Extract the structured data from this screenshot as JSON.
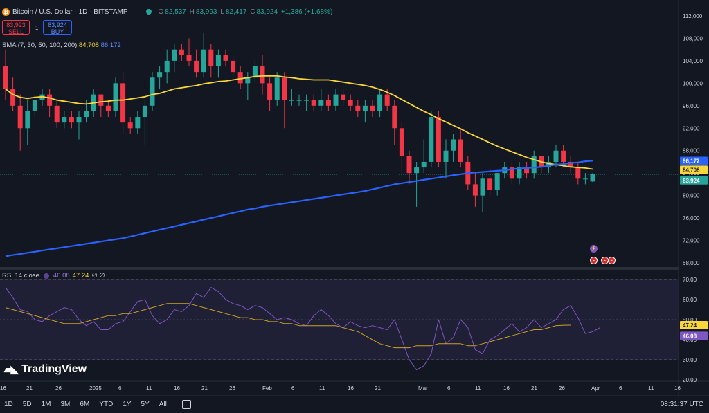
{
  "header": {
    "pair": "Bitcoin / U.S. Dollar · 1D · BITSTAMP",
    "open_label": "O",
    "open": "82,537",
    "high_label": "H",
    "high": "83,993",
    "low_label": "L",
    "low": "82,417",
    "close_label": "C",
    "close": "83,924",
    "change": "+1,386 (+1.68%)"
  },
  "trade": {
    "sell_price": "83,923",
    "sell_label": "SELL",
    "spread": "1",
    "buy_price": "83,924",
    "buy_label": "BUY"
  },
  "sma": {
    "label": "SMA (7, 30, 50, 100, 200)",
    "val1": "84,708",
    "val2": "86,172"
  },
  "rsi": {
    "label": "RSI 14 close",
    "val1": "46.08",
    "val2": "47.24",
    "rest": "∅ ∅"
  },
  "price_axis": [
    "112,000",
    "108,000",
    "104,000",
    "100,000",
    "96,000",
    "92,000",
    "88,000",
    "84,000",
    "80,000",
    "76,000",
    "72,000",
    "68,000"
  ],
  "price_tags": {
    "sma200": "86,172",
    "sma50": "84,708",
    "last": "83,924"
  },
  "rsi_axis": [
    "70.00",
    "60.00",
    "50.00",
    "40.00",
    "30.00",
    "20.00"
  ],
  "rsi_tags": {
    "ma": "47.24",
    "rsi": "46.08"
  },
  "time_axis": [
    "16",
    "21",
    "26",
    "2025",
    "6",
    "11",
    "16",
    "21",
    "26",
    "Feb",
    "6",
    "11",
    "16",
    "21",
    "Mar",
    "6",
    "11",
    "16",
    "21",
    "26",
    "Apr",
    "6",
    "11",
    "16"
  ],
  "logo": "TradingView",
  "bottom": {
    "timeframes": [
      "1D",
      "5D",
      "1M",
      "3M",
      "6M",
      "YTD",
      "1Y",
      "5Y",
      "All"
    ],
    "clock": "08:31:37 UTC"
  },
  "colors": {
    "bg": "#131722",
    "up": "#26a69a",
    "down": "#f23645",
    "sma_yellow": "#f7d73b",
    "sma_blue": "#2962ff",
    "rsi": "#7e57c2"
  },
  "chart_data": {
    "type": "candlestick",
    "series": [
      {
        "name": "BTC/USD",
        "ohlc_k": [
          [
            103,
            106,
            97,
            99
          ],
          [
            99,
            101,
            95,
            96
          ],
          [
            96,
            98,
            88,
            92
          ],
          [
            92,
            97,
            89,
            95
          ],
          [
            95,
            98,
            94,
            97
          ],
          [
            97,
            99,
            96,
            98
          ],
          [
            98,
            99,
            94,
            96
          ],
          [
            96,
            97,
            92,
            93
          ],
          [
            93,
            95,
            92,
            94
          ],
          [
            94,
            95,
            92,
            93
          ],
          [
            93,
            95,
            90,
            94
          ],
          [
            94,
            97,
            93,
            95
          ],
          [
            95,
            99,
            94,
            98
          ],
          [
            98,
            98,
            94,
            96
          ],
          [
            96,
            97,
            94,
            95
          ],
          [
            95,
            101,
            94,
            100
          ],
          [
            100,
            102,
            91,
            93
          ],
          [
            93,
            94,
            91,
            92
          ],
          [
            92,
            95,
            91,
            94
          ],
          [
            94,
            97,
            89,
            96
          ],
          [
            96,
            102,
            95,
            101
          ],
          [
            101,
            103,
            99,
            102
          ],
          [
            102,
            106,
            100,
            104
          ],
          [
            104,
            107,
            102,
            106
          ],
          [
            106,
            107,
            104,
            105
          ],
          [
            105,
            108,
            103,
            104
          ],
          [
            104,
            106,
            101,
            102
          ],
          [
            102,
            109,
            101,
            106
          ],
          [
            106,
            107,
            101,
            103
          ],
          [
            103,
            106,
            101,
            105
          ],
          [
            105,
            106,
            103,
            104
          ],
          [
            104,
            105,
            101,
            102
          ],
          [
            102,
            103,
            99,
            100
          ],
          [
            100,
            102,
            97,
            101
          ],
          [
            101,
            104,
            100,
            103
          ],
          [
            103,
            105,
            98,
            100
          ],
          [
            100,
            101,
            95,
            97
          ],
          [
            97,
            102,
            96,
            101
          ],
          [
            101,
            102,
            92,
            97
          ],
          [
            97,
            99,
            96,
            97
          ],
          [
            97,
            98,
            96,
            97
          ],
          [
            97,
            98,
            95,
            97
          ],
          [
            97,
            98,
            95,
            96
          ],
          [
            96,
            99,
            95,
            97
          ],
          [
            97,
            98,
            95,
            96
          ],
          [
            96,
            99,
            95,
            98
          ],
          [
            98,
            99,
            96,
            97
          ],
          [
            97,
            98,
            95,
            96
          ],
          [
            96,
            97,
            94,
            95
          ],
          [
            95,
            97,
            93,
            96
          ],
          [
            96,
            97,
            94,
            95
          ],
          [
            95,
            99,
            94,
            98
          ],
          [
            98,
            99,
            95,
            96
          ],
          [
            96,
            97,
            89,
            92
          ],
          [
            92,
            93,
            84,
            87
          ],
          [
            87,
            88,
            82,
            84
          ],
          [
            84,
            86,
            78,
            85
          ],
          [
            85,
            90,
            84,
            86
          ],
          [
            86,
            95,
            85,
            94
          ],
          [
            94,
            95,
            85,
            86
          ],
          [
            86,
            90,
            83,
            88
          ],
          [
            88,
            91,
            86,
            90
          ],
          [
            90,
            92,
            85,
            86
          ],
          [
            86,
            87,
            81,
            82
          ],
          [
            82,
            84,
            78,
            80
          ],
          [
            80,
            84,
            77,
            83
          ],
          [
            83,
            85,
            80,
            81
          ],
          [
            81,
            84,
            80,
            84
          ],
          [
            84,
            86,
            83,
            85
          ],
          [
            85,
            86,
            82,
            83
          ],
          [
            83,
            86,
            82,
            85
          ],
          [
            85,
            86,
            83,
            84
          ],
          [
            84,
            88,
            83,
            87
          ],
          [
            87,
            87,
            84,
            85
          ],
          [
            85,
            87,
            84,
            86
          ],
          [
            86,
            89,
            85,
            88
          ],
          [
            88,
            89,
            85,
            86
          ],
          [
            86,
            87,
            84,
            85
          ],
          [
            85,
            86,
            82,
            83
          ],
          [
            83,
            84,
            82,
            83
          ],
          [
            82.5,
            84,
            82.4,
            83.9
          ]
        ]
      },
      {
        "name": "SMA 50",
        "y_k": [
          99,
          98,
          97.5,
          97.3,
          97.5,
          97.6,
          97.4,
          97,
          96.8,
          96.6,
          96.4,
          96.3,
          96.5,
          96.7,
          96.8,
          97,
          97,
          97.2,
          97.4,
          97.6,
          98,
          98.2,
          98.6,
          99,
          99.2,
          99.4,
          99.6,
          99.9,
          100.1,
          100.3,
          100.4,
          100.6,
          100.8,
          101,
          101.2,
          101.3,
          101.3,
          101.3,
          101.1,
          101,
          100.8,
          100.7,
          100.6,
          100.6,
          100.6,
          100.4,
          100.2,
          100,
          99.8,
          99.6,
          99.3,
          98.9,
          98.4,
          97.8,
          97.1,
          96.4,
          95.7,
          95,
          94.4,
          93.7,
          93.1,
          92.5,
          91.9,
          91.2,
          90.6,
          90,
          89.4,
          88.8,
          88.3,
          87.8,
          87.3,
          86.8,
          86.4,
          86,
          85.7,
          85.5,
          85.3,
          85.1,
          85,
          84.9,
          84.7
        ]
      },
      {
        "name": "SMA 200",
        "y_k": [
          69.2,
          69.4,
          69.6,
          69.8,
          70,
          70.2,
          70.4,
          70.6,
          70.8,
          71,
          71.2,
          71.4,
          71.6,
          71.8,
          72,
          72.2,
          72.4,
          72.7,
          73,
          73.3,
          73.6,
          73.9,
          74.2,
          74.5,
          74.8,
          75.1,
          75.4,
          75.7,
          76,
          76.3,
          76.6,
          76.9,
          77.2,
          77.5,
          77.7,
          78,
          78.2,
          78.4,
          78.6,
          78.8,
          79,
          79.2,
          79.4,
          79.6,
          79.8,
          80,
          80.2,
          80.4,
          80.6,
          80.8,
          81.1,
          81.4,
          81.7,
          82,
          82.2,
          82.4,
          82.6,
          82.8,
          83,
          83.2,
          83.4,
          83.6,
          83.8,
          84,
          84.1,
          84.2,
          84.3,
          84.4,
          84.5,
          84.7,
          84.8,
          84.9,
          85,
          85.1,
          85.3,
          85.5,
          85.6,
          85.8,
          85.9,
          86.1,
          86.2
        ]
      },
      {
        "name": "RSI 14",
        "y": [
          66,
          61,
          55,
          54,
          50,
          49,
          52,
          54,
          56,
          55,
          50,
          47,
          49,
          45,
          45,
          48,
          49,
          54,
          59,
          60,
          52,
          48,
          50,
          55,
          54,
          57,
          63,
          61,
          66,
          64,
          60,
          58,
          57,
          55,
          57,
          56,
          53,
          50,
          51,
          50,
          48,
          47,
          52,
          55,
          52,
          48,
          46,
          49,
          47,
          46,
          47,
          46,
          45,
          50,
          40,
          30,
          25,
          27,
          33,
          50,
          38,
          41,
          50,
          46,
          35,
          33,
          40,
          42,
          45,
          48,
          44,
          46,
          50,
          46,
          48,
          50,
          55,
          57,
          51,
          43,
          44,
          46
        ]
      },
      {
        "name": "RSI MA",
        "y": [
          56,
          55,
          54,
          53,
          52,
          51,
          50,
          49,
          48,
          48,
          48,
          49,
          50,
          51,
          52,
          52,
          53,
          53,
          54,
          55,
          56,
          57,
          58,
          58,
          58,
          58,
          57,
          56,
          55,
          54,
          53,
          52,
          51,
          51,
          50,
          50,
          49,
          49,
          48,
          48,
          47,
          47,
          47,
          47,
          47,
          47,
          46,
          45,
          44,
          42,
          40,
          38,
          37,
          36,
          36,
          36,
          37,
          37,
          37,
          38,
          38,
          38,
          38,
          37,
          37,
          38,
          39,
          40,
          41,
          42,
          43,
          44,
          45,
          45,
          46,
          47,
          47.2,
          47.24
        ]
      }
    ]
  }
}
